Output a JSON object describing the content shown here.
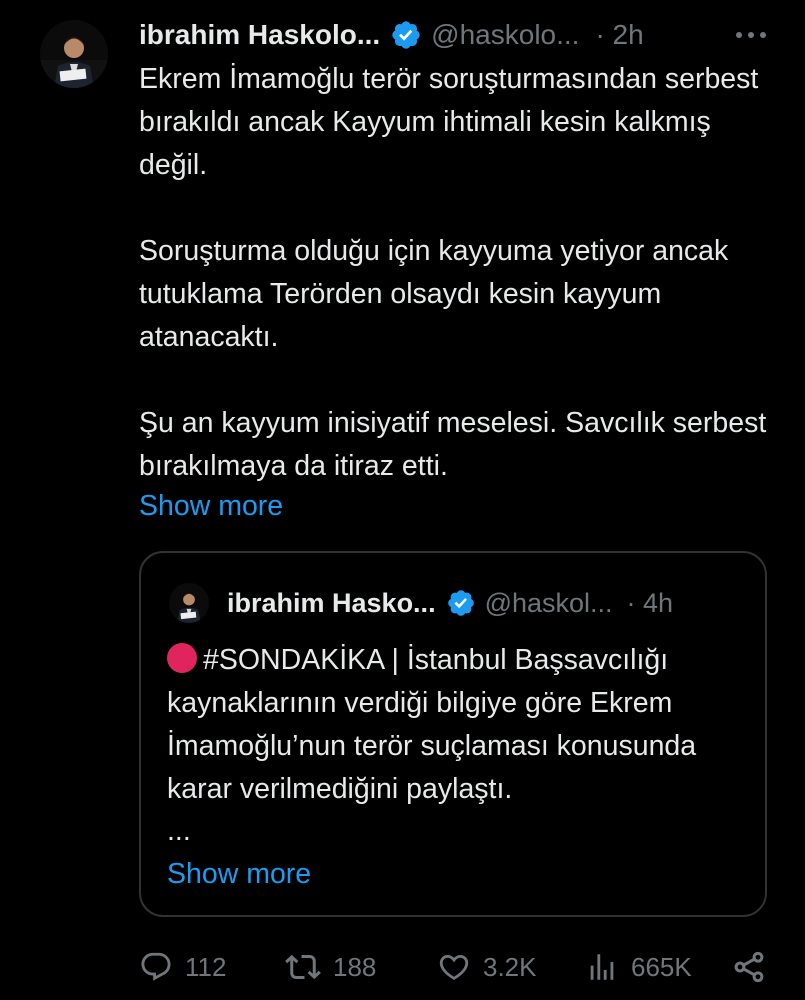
{
  "author": {
    "name": "ibrahim Haskolo...",
    "handle": "@haskolo...",
    "time": "· 2h"
  },
  "tweet": {
    "paragraphs": [
      "Ekrem İmamoğlu terör soruşturmasından serbest bırakıldı ancak Kayyum ihtimali kesin kalkmış değil.",
      "Soruşturma olduğu için kayyuma yetiyor ancak tutuklama Terörden olsaydı kesin kayyum atanacaktı.",
      "Şu an kayyum inisiyatif meselesi. Savcılık serbest bırakılmaya da itiraz etti."
    ],
    "show_more": "Show more"
  },
  "quote": {
    "name": "ibrahim Hasko...",
    "handle": "@haskol...",
    "time": "· 4h",
    "text": "#SONDAKİKA | İstanbul Başsavcılığı kaynaklarının verdiği bilgiye göre Ekrem İmamoğlu’nun terör suçlaması konusunda karar verilmediğini paylaştı.",
    "ellipsis": "...",
    "show_more": "Show more"
  },
  "actions": {
    "replies": "112",
    "reposts": "188",
    "likes": "3.2K",
    "views": "665K"
  },
  "colors": {
    "background": "#000000",
    "text": "#e7e9ea",
    "secondary": "#71767b",
    "link": "#1d9bf0",
    "verified": "#1d9bf0",
    "border": "#2f3336",
    "red_dot": "#e0245e"
  },
  "icons": {
    "verified": "verified-badge-icon",
    "more": "more-options-icon",
    "reply": "reply-icon",
    "repost": "repost-icon",
    "like": "like-icon",
    "views": "views-icon",
    "share": "share-icon"
  }
}
